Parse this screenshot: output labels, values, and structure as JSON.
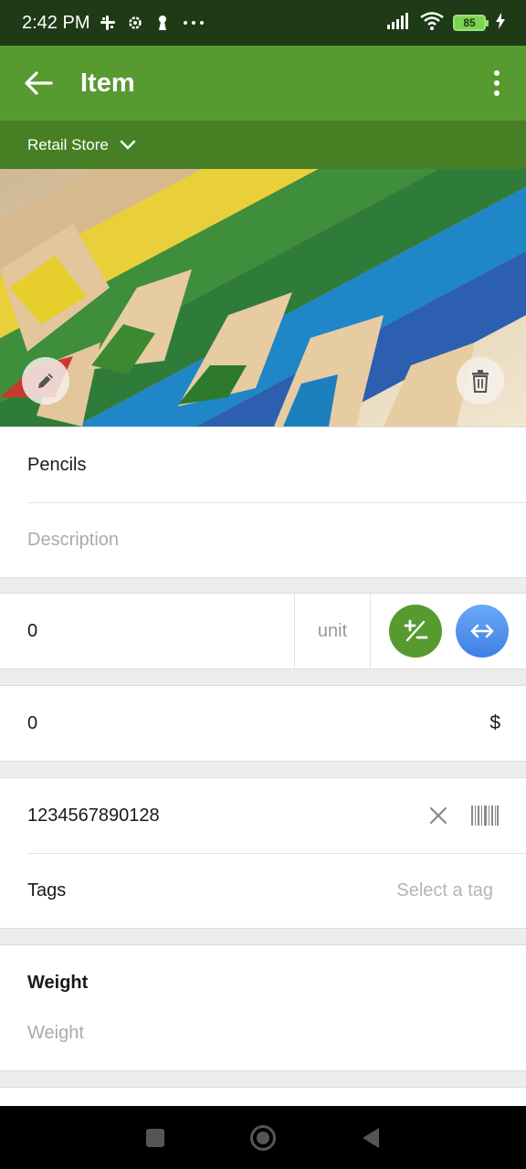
{
  "status_bar": {
    "time": "2:42 PM",
    "icons_left": [
      "slack-icon",
      "settings-icon",
      "keyhole-icon",
      "more-dots-icon"
    ],
    "icons_right": [
      "signal-icon",
      "wifi-icon",
      "battery-icon",
      "charging-icon"
    ],
    "battery_level": "85"
  },
  "app_bar": {
    "title": "Item",
    "back_icon": "arrow-left-icon",
    "menu_icon": "more-vert-icon",
    "color": "#579a30"
  },
  "store_selector": {
    "label": "Retail Store",
    "icon": "chevron-down-icon",
    "color": "#477f24"
  },
  "photo": {
    "subject": "colored pencils",
    "edit_icon": "pencil-icon",
    "delete_icon": "trash-icon"
  },
  "details": {
    "name": "Pencils",
    "description_placeholder": "Description"
  },
  "quantity": {
    "value": "0",
    "unit_placeholder": "unit",
    "adjust_icon": "plus-minus-icon",
    "transfer_icon": "swap-horizontal-icon"
  },
  "price": {
    "value": "0",
    "currency": "$"
  },
  "barcode": {
    "value": "1234567890128",
    "clear_icon": "close-icon",
    "scan_icon": "barcode-icon"
  },
  "tags": {
    "label": "Tags",
    "placeholder": "Select a tag"
  },
  "weight": {
    "title": "Weight",
    "placeholder": "Weight"
  },
  "nav_bar": {
    "icons": [
      "recents-square-icon",
      "home-circle-icon",
      "back-triangle-icon"
    ]
  }
}
